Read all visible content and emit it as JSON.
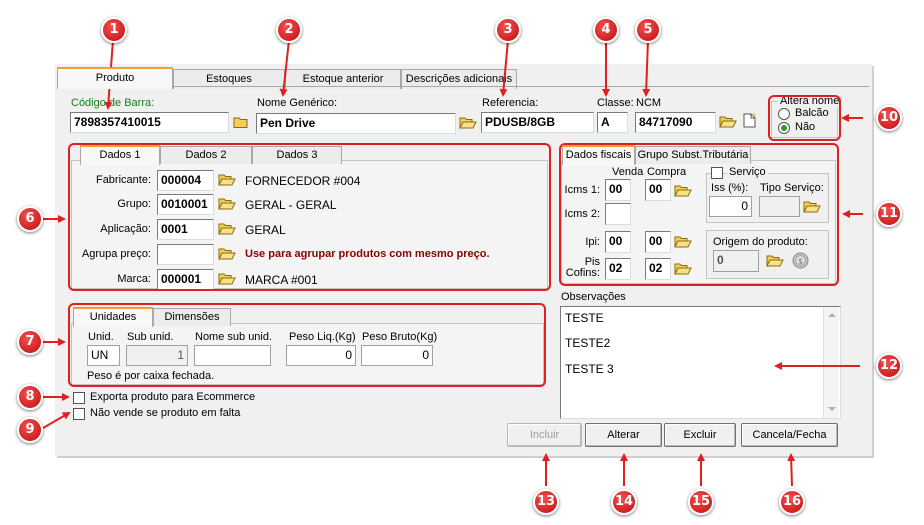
{
  "tabs": [
    "Produto",
    "Estoques",
    "Estoque anterior",
    "Descrições adicionais"
  ],
  "header": {
    "codigo_label": "Código de Barra:",
    "codigo_value": "7898357410015",
    "nome_label": "Nome Genérico:",
    "nome_value": "Pen Drive",
    "ref_label": "Referencia:",
    "ref_value": "PDUSB/8GB",
    "classe_label": "Classe:",
    "classe_value": "A",
    "ncm_label": "NCM",
    "ncm_value": "84717090",
    "altera_nome_label": "Altera nome",
    "altera_options": [
      "Balcão",
      "Não"
    ],
    "altera_selected": "Não"
  },
  "dados": {
    "tabs": [
      "Dados 1",
      "Dados 2",
      "Dados 3"
    ],
    "fabricante_label": "Fabricante:",
    "fabricante_code": "000004",
    "fabricante_name": "FORNECEDOR #004",
    "grupo_label": "Grupo:",
    "grupo_code": "0010001",
    "grupo_name": "GERAL - GERAL",
    "aplicacao_label": "Aplicação:",
    "aplicacao_code": "0001",
    "aplicacao_name": "GERAL",
    "agrupa_label": "Agrupa preço:",
    "agrupa_code": "",
    "agrupa_hint": "Use para agrupar produtos com mesmo preço.",
    "marca_label": "Marca:",
    "marca_code": "000001",
    "marca_name": "MARCA #001"
  },
  "fiscais": {
    "tabs": [
      "Dados fiscais",
      "Grupo Subst.Tributária"
    ],
    "venda_label": "Venda",
    "compra_label": "Compra",
    "icms1_label": "Icms 1:",
    "icms1_venda": "00",
    "icms1_compra": "00",
    "icms2_label": "Icms 2:",
    "icms2_venda": "",
    "ipi_label": "Ipi:",
    "ipi_venda": "00",
    "ipi_compra": "00",
    "pis_label_1": "Pis",
    "pis_label_2": "Cofins:",
    "pis_venda": "02",
    "pis_compra": "02",
    "servico_label": "Serviço",
    "iss_label": "Iss (%):",
    "iss_value": "0",
    "tipo_servico_label": "Tipo Serviço:",
    "tipo_servico_value": "",
    "origem_label": "Origem do produto:",
    "origem_value": "0"
  },
  "unidades": {
    "tabs": [
      "Unidades",
      "Dimensões"
    ],
    "unid_label": "Unid.",
    "unid_value": "UN",
    "sub_unid_label": "Sub unid.",
    "sub_unid_value": "1",
    "nome_sub_label": "Nome sub unid.",
    "nome_sub_value": "",
    "peso_liq_label": "Peso Liq.(Kg)",
    "peso_liq_value": "0",
    "peso_bruto_label": "Peso Bruto(Kg)",
    "peso_bruto_value": "0",
    "note": "Peso é por caixa fechada."
  },
  "observacoes": {
    "label": "Observações",
    "lines": [
      "TESTE",
      "TESTE2",
      "TESTE 3"
    ]
  },
  "checks": {
    "ecommerce": "Exporta produto para Ecommerce",
    "falta": "Não vende se produto em falta"
  },
  "buttons": {
    "incluir": "Incluir",
    "alterar": "Alterar",
    "excluir": "Excluir",
    "cancela": "Cancela/Fecha"
  },
  "callouts": [
    "1",
    "2",
    "3",
    "4",
    "5",
    "6",
    "7",
    "8",
    "9",
    "10",
    "11",
    "12",
    "13",
    "14",
    "15",
    "16"
  ],
  "colors": {
    "callout_red": "#d81e1e",
    "tab_accent": "#f0a030",
    "label_green": "#1b7a1b",
    "hint_red": "#8b0000"
  }
}
